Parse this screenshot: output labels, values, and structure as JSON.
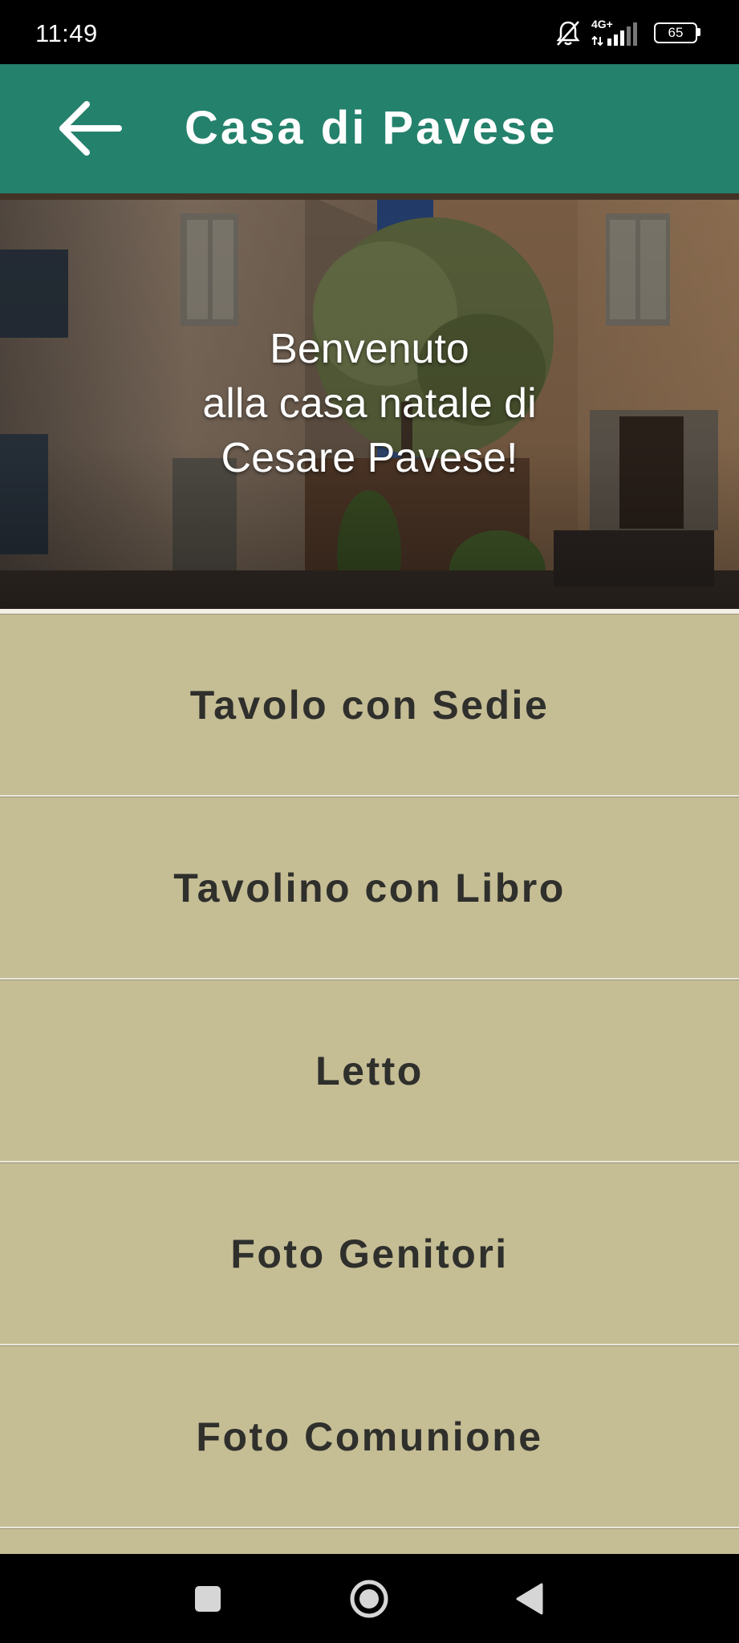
{
  "status_bar": {
    "time": "11:49",
    "network": "4G+",
    "battery": "65",
    "icons": [
      "bell-off-icon",
      "signal-icon",
      "battery-icon"
    ]
  },
  "app_bar": {
    "title": "Casa di Pavese",
    "back_icon": "arrow-left-icon",
    "background_color": "#24816b"
  },
  "hero": {
    "line1": "Benvenuto",
    "line2": "alla casa natale di",
    "line3": "Cesare Pavese!"
  },
  "menu": {
    "items": [
      {
        "label": "Tavolo con Sedie"
      },
      {
        "label": "Tavolino con Libro"
      },
      {
        "label": "Letto"
      },
      {
        "label": "Foto Genitori"
      },
      {
        "label": "Foto Comunione"
      }
    ],
    "background_color": "#c5bd94"
  },
  "nav_bar": {
    "icons": [
      "recents-square-icon",
      "home-circle-icon",
      "back-triangle-icon"
    ]
  }
}
